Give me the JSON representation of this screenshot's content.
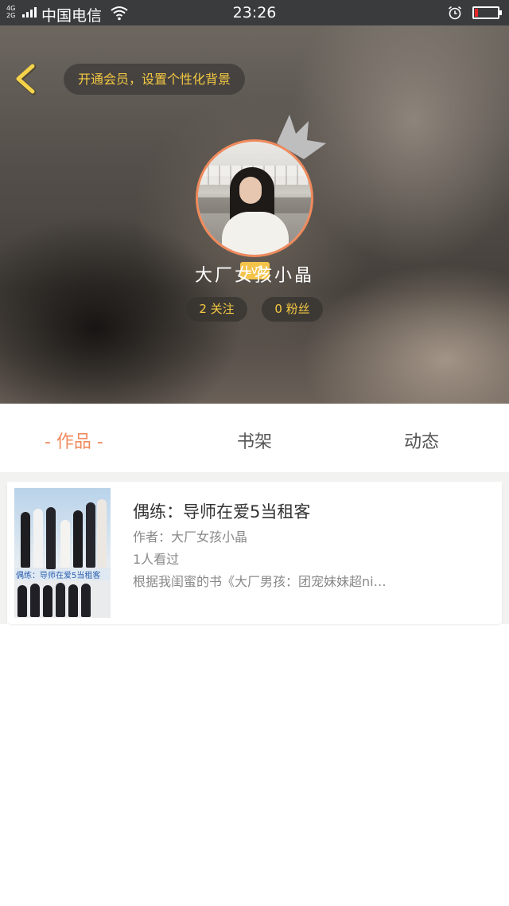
{
  "status_bar": {
    "network": "4G\n2G",
    "carrier": "中国电信",
    "time": "23:26",
    "battery_level": 0.15,
    "battery_color": "#e8262a",
    "icons": [
      "signal-icon",
      "wifi-icon",
      "alarm-icon",
      "battery-icon"
    ]
  },
  "header": {
    "back_icon": "chevron-left-icon",
    "vip_text": "开通会员，设置个性化背景",
    "level": "Lv1",
    "username": "大厂女孩小晶",
    "follow": {
      "count": "2",
      "label": "关注"
    },
    "fans": {
      "count": "0",
      "label": "粉丝"
    },
    "accent_color": "#f4c942",
    "avatar_ring_color": "#f08a5c"
  },
  "tabs": [
    {
      "label": "- 作品 -",
      "active": true
    },
    {
      "label": "书架",
      "active": false
    },
    {
      "label": "动态",
      "active": false
    }
  ],
  "book": {
    "title": "偶练：导师在爱5当租客",
    "author": "作者：大厂女孩小晶",
    "views": "1人看过",
    "description": "根据我闺蜜的书《大厂男孩：团宠妹妹超ni…",
    "cover_text": "偶练：导师在爱5当租客"
  },
  "colors": {
    "active_tab": "#f08a5c",
    "inactive_tab": "#555555",
    "status_bar_bg": "#3a3b3d"
  }
}
